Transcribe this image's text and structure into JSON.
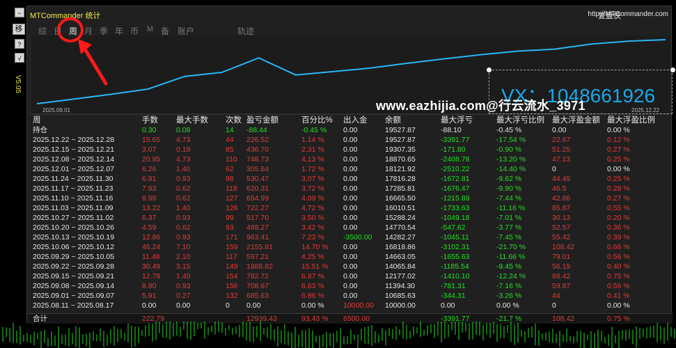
{
  "app": {
    "title": "MTCommander 统计",
    "replay_label": "复盘侠",
    "website": "http://MTCommander.com",
    "version": "V5.05"
  },
  "left_toolbar": [
    {
      "label": "−",
      "name": "minimize-icon"
    },
    {
      "label": "移",
      "name": "move-button"
    },
    {
      "label": "?",
      "name": "help-icon"
    },
    {
      "label": "√",
      "name": "check-icon"
    }
  ],
  "tabs": [
    {
      "label": "综"
    },
    {
      "label": "日"
    },
    {
      "label": "周"
    },
    {
      "label": "月"
    },
    {
      "label": "季"
    },
    {
      "label": "年"
    },
    {
      "label": "币"
    },
    {
      "label": "M"
    },
    {
      "label": "备"
    },
    {
      "label": "账户"
    },
    {
      "label": "轨迹"
    }
  ],
  "active_tab": "周",
  "overlay": {
    "watermark": "www.eazhijia.com@行云流水_3971",
    "vx_text": "VX：1048661926"
  },
  "chart_data": {
    "type": "line",
    "x_start_label": "2025.09.01",
    "x_end_label": "2025.12.22",
    "x": [
      "2025.08.11",
      "2025.09.01",
      "2025.09.08",
      "2025.09.15",
      "2025.09.22",
      "2025.09.29",
      "2025.10.06",
      "2025.10.13",
      "2025.10.20",
      "2025.10.27",
      "2025.11.03",
      "2025.11.10",
      "2025.11.17",
      "2025.11.24",
      "2025.12.01",
      "2025.12.08",
      "2025.12.15",
      "2025.12.22"
    ],
    "values": [
      10000,
      10685.63,
      11394.3,
      12177.02,
      14065.84,
      14663.05,
      16818.86,
      14282.27,
      14770.54,
      15288.24,
      16010.51,
      16665.5,
      17285.81,
      17816.28,
      18121.92,
      18870.65,
      19307.35,
      19527.87
    ],
    "line_color": "#29b6f6"
  },
  "table": {
    "headers": [
      "周",
      "手数",
      "最大手数",
      "次数",
      "盈亏金额",
      "百分比%",
      "出入金",
      "余额",
      "最大浮亏",
      "最大浮亏比例",
      "最大浮盈金额",
      "最大浮盈比例"
    ],
    "holding": [
      "持仓",
      "0.30",
      "0.08",
      "14",
      "-88.44",
      "-0.45 %",
      "0.00",
      "19527.87",
      "-88.10",
      "-0.45 %",
      "0.00",
      "0.00 %"
    ],
    "rows": [
      [
        "2025.12.22 ~ 2025.12.28",
        "15.65",
        "4.73",
        "44",
        "226.52",
        "1.14 %",
        "0.00",
        "19527.87",
        "-3391.77",
        "-17.54 %",
        "22.67",
        "0.12 %"
      ],
      [
        "2025.12.15 ~ 2025.12.21",
        "3.07",
        "0.18",
        "85",
        "436.70",
        "2.31 %",
        "0.00",
        "19307.35",
        "-171.80",
        "-0.90 %",
        "51.25",
        "0.27 %"
      ],
      [
        "2025.12.08 ~ 2025.12.14",
        "20.85",
        "4.73",
        "110",
        "748.73",
        "4.13 %",
        "0.00",
        "18870.65",
        "-2408.78",
        "-13.20 %",
        "47.13",
        "0.25 %"
      ],
      [
        "2025.12.01 ~ 2025.12.07",
        "6.26",
        "1.40",
        "62",
        "305.64",
        "1.72 %",
        "0.00",
        "18121.92",
        "-2510.22",
        "-14.40 %",
        "0",
        "0.00 %"
      ],
      [
        "2025.11.24 ~ 2025.11.30",
        "6.91",
        "0.93",
        "98",
        "530.47",
        "3.07 %",
        "0.00",
        "17816.28",
        "-1672.81",
        "-9.62 %",
        "44.49",
        "0.25 %"
      ],
      [
        "2025.11.17 ~ 2025.11.23",
        "7.93",
        "0.62",
        "118",
        "620.31",
        "3.72 %",
        "0.00",
        "17285.81",
        "-1676.47",
        "-9.90 %",
        "46.5",
        "0.28 %"
      ],
      [
        "2025.11.10 ~ 2025.11.16",
        "8.98",
        "0.62",
        "127",
        "654.99",
        "4.09 %",
        "0.00",
        "16665.50",
        "-1215.89",
        "-7.44 %",
        "42.86",
        "0.27 %"
      ],
      [
        "2025.11.03 ~ 2025.11.09",
        "13.22",
        "1.40",
        "126",
        "722.27",
        "4.72 %",
        "0.00",
        "16010.51",
        "-1733.63",
        "-11.16 %",
        "85.87",
        "0.55 %"
      ],
      [
        "2025.10.27 ~ 2025.11.02",
        "6.37",
        "0.93",
        "99",
        "517.70",
        "3.50 %",
        "0.00",
        "15288.24",
        "-1049.18",
        "-7.01 %",
        "30.13",
        "0.20 %"
      ],
      [
        "2025.10.20 ~ 2025.10.26",
        "4.59",
        "0.62",
        "93",
        "488.27",
        "3.42 %",
        "0.00",
        "14770.54",
        "-547.62",
        "-3.77 %",
        "52.57",
        "0.36 %"
      ],
      [
        "2025.10.13 ~ 2025.10.19",
        "12.86",
        "0.93",
        "171",
        "963.41",
        "7.23 %",
        "-3500.00",
        "14282.27",
        "-1045.11",
        "-7.45 %",
        "55.42",
        "0.39 %"
      ],
      [
        "2025.10.06 ~ 2025.10.12",
        "46.24",
        "7.10",
        "159",
        "2155.81",
        "14.70 %",
        "0.00",
        "16818.86",
        "-3102.31",
        "-21.70 %",
        "108.42",
        "0.66 %"
      ],
      [
        "2025.09.29 ~ 2025.10.05",
        "11.48",
        "2.10",
        "117",
        "597.21",
        "4.25 %",
        "0.00",
        "14663.05",
        "-1655.63",
        "-11.66 %",
        "79.01",
        "0.56 %"
      ],
      [
        "2025.09.22 ~ 2025.09.28",
        "30.49",
        "3.15",
        "149",
        "1888.82",
        "15.51 %",
        "0.00",
        "14065.84",
        "-1185.54",
        "-9.45 %",
        "56.19",
        "0.40 %"
      ],
      [
        "2025.09.15 ~ 2025.09.21",
        "12.78",
        "1.40",
        "154",
        "782.72",
        "6.87 %",
        "0.00",
        "12177.02",
        "-1410.10",
        "-12.24 %",
        "88.42",
        "0.75 %"
      ],
      [
        "2025.09.08 ~ 2025.09.14",
        "8.90",
        "0.93",
        "156",
        "708.67",
        "6.63 %",
        "0.00",
        "11394.30",
        "-781.31",
        "-7.16 %",
        "59.87",
        "0.56 %"
      ],
      [
        "2025.09.01 ~ 2025.09.07",
        "5.91",
        "0.27",
        "132",
        "685.63",
        "6.86 %",
        "0.00",
        "10685.63",
        "-344.31",
        "-3.26 %",
        "44",
        "0.41 %"
      ],
      [
        "2025.08.11 ~ 2025.08.17",
        "0.00",
        "0.00",
        "0",
        "0.00",
        "0.00 %",
        "10000.00",
        "10000.00",
        "0.00",
        "0.00 %",
        "0",
        "0.00 %"
      ]
    ],
    "total": [
      "合计",
      "222.79",
      "",
      "",
      "12939.43",
      "93.43 %",
      "6500.00",
      "",
      "-3391.77",
      "-21.7 %",
      "108.42",
      "0.75 %"
    ]
  },
  "colors": {
    "title_yellow": "#f5e84a",
    "loss_red": "#e23a3a",
    "gain_green": "#22e022",
    "annotation_red": "#ff1a1a",
    "vx_blue": "#1aa8e8"
  }
}
